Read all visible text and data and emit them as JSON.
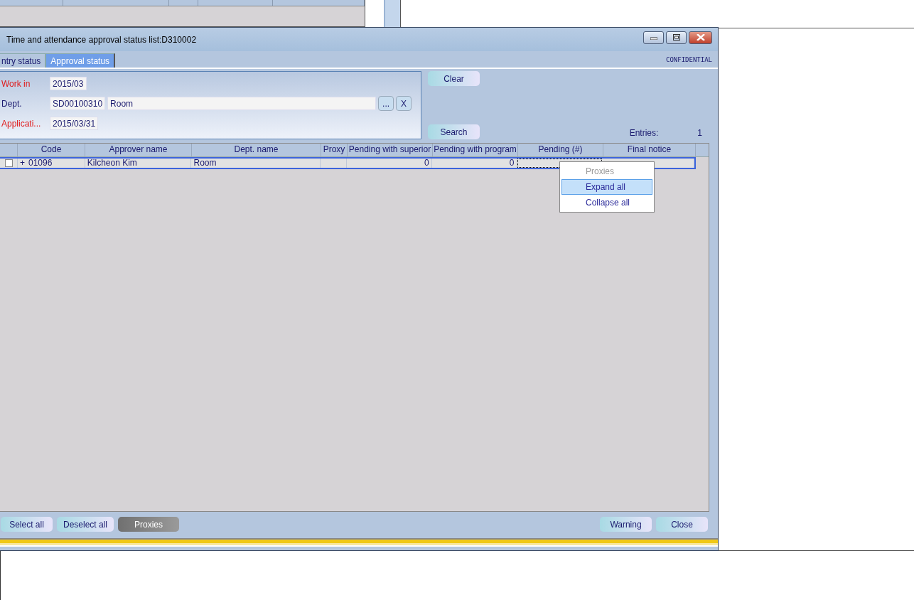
{
  "window": {
    "title": "Time and attendance approval status list:D310002"
  },
  "tabs": [
    {
      "label": "ntry status",
      "selected": false
    },
    {
      "label": "Approval status",
      "selected": true
    }
  ],
  "confidential_label": "CONFIDENTIAL",
  "filters": [
    {
      "label": "Work in",
      "required": true,
      "fields": [
        "2015/03"
      ]
    },
    {
      "label": "Dept.",
      "required": false,
      "fields": [
        "SD00100310",
        "Room"
      ],
      "buttons": [
        "...",
        "X"
      ]
    },
    {
      "label": "Applicati...",
      "required": true,
      "fields": [
        "2015/03/31"
      ]
    }
  ],
  "clear_button": "Clear",
  "search_button": "Search",
  "entries": {
    "label": "Entries:",
    "value": "1"
  },
  "table": {
    "columns": [
      {
        "label": "Code",
        "kind": "text"
      },
      {
        "label": "Approver name",
        "kind": "text"
      },
      {
        "label": "Dept. name",
        "kind": "text"
      },
      {
        "label": "Proxy",
        "kind": "text"
      },
      {
        "label": "Pending with superior",
        "kind": "number"
      },
      {
        "label": "Pending with program",
        "kind": "number"
      },
      {
        "label": "Pending (#)",
        "kind": "number"
      },
      {
        "label": "Final notice",
        "kind": "text"
      }
    ],
    "rows": [
      {
        "checked": false,
        "selected": true,
        "expander": "+",
        "cells": [
          {
            "text": "01096",
            "focused": false
          },
          {
            "text": "Kilcheon Kim",
            "focused": false
          },
          {
            "text": "Room",
            "focused": false
          },
          {
            "focused": false
          },
          {
            "text": "0",
            "focused": false
          },
          {
            "text": "0",
            "focused": false
          },
          {
            "focused": true
          },
          {
            "focused": false
          }
        ]
      }
    ]
  },
  "context_menu": [
    {
      "label": "Proxies",
      "disabled": true,
      "selected": false
    },
    {
      "label": "Expand all",
      "disabled": false,
      "selected": true
    },
    {
      "label": "Collapse all",
      "disabled": false,
      "selected": false
    }
  ],
  "left_buttons": [
    {
      "label": "Select all",
      "disabled": false
    },
    {
      "label": "Deselect all",
      "disabled": false
    },
    {
      "label": "Proxies",
      "disabled": true
    }
  ],
  "right_buttons": [
    {
      "label": "Warning",
      "disabled": false
    },
    {
      "label": "Close",
      "disabled": false
    }
  ]
}
